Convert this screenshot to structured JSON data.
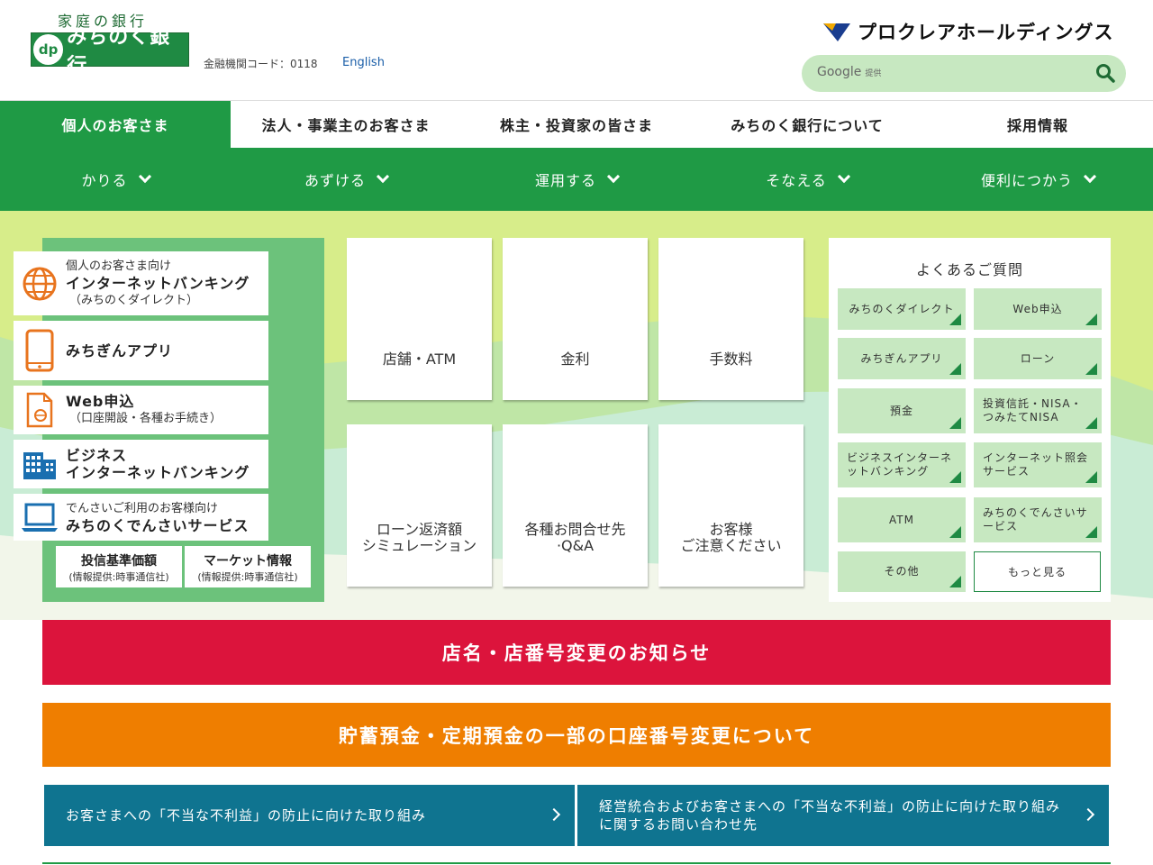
{
  "header": {
    "logo_tagline": "家庭の銀行",
    "logo_mark": "dp",
    "logo_name": "みちのく銀行",
    "bank_code": "金融機関コード：0118",
    "english_link": "English",
    "holdings_name": "プロクレアホールディングス",
    "search": {
      "brand": "Google",
      "brand_sub": "提供",
      "placeholder": ""
    }
  },
  "main_nav": [
    {
      "label": "個人のお客さま",
      "active": true
    },
    {
      "label": "法人・事業主のお客さま"
    },
    {
      "label": "株主・投資家の皆さま"
    },
    {
      "label": "みちのく銀行について"
    },
    {
      "label": "採用情報"
    }
  ],
  "sub_nav": [
    {
      "label": "かりる"
    },
    {
      "label": "あずける"
    },
    {
      "label": "運用する"
    },
    {
      "label": "そなえる"
    },
    {
      "label": "便利につかう"
    }
  ],
  "left_panel": {
    "internet_banking": {
      "small": "個人のお客さま向け",
      "big": "インターネットバンキング",
      "sub": "（みちのくダイレクト）"
    },
    "app": {
      "big": "みちぎんアプリ"
    },
    "web_apply": {
      "big": "Web申込",
      "sub": "（口座開設・各種お手続き）"
    },
    "business_ib": {
      "big1": "ビジネス",
      "big2": "インターネットバンキング"
    },
    "densai": {
      "small": "でんさいご利用のお客様向け",
      "big": "みちのくでんさいサービス"
    },
    "fund_price": {
      "title": "投信基準価額",
      "sub": "(情報提供:時事通信社)"
    },
    "market": {
      "title": "マーケット情報",
      "sub": "(情報提供:時事通信社)"
    }
  },
  "tiles": {
    "store_atm": "店舗・ATM",
    "rates": "金利",
    "fees": "手数料",
    "loan_sim_1": "ローン返済額",
    "loan_sim_2": "シミュレーション",
    "contact_1": "各種お問合せ先",
    "contact_2": "·Q&A",
    "caution_1": "お客様",
    "caution_2": "ご注意ください"
  },
  "faq": {
    "title": "よくあるご質問",
    "items": [
      "みちのくダイレクト",
      "Web申込",
      "みちぎんアプリ",
      "ローン",
      "預金",
      "投資信託・NISA・つみたてNISA",
      "ビジネスインターネットバンキング",
      "インターネット照会サービス",
      "ATM",
      "みちのくでんさいサービス",
      "その他"
    ],
    "more": "もっと見る"
  },
  "notices": {
    "red": "店名・店番号変更のお知らせ",
    "orange": "貯蓄預金・定期預金の一部の口座番号変更について",
    "info_left": "お客さまへの「不当な不利益」の防止に向けた取り組み",
    "info_right": "経営統合およびお客さまへの「不当な不利益」の防止に向けた取り組みに関するお問い合わせ先"
  },
  "colors": {
    "brand_green": "#1f9a45",
    "light_green": "#c7e8c1",
    "notice_red": "#dc143c",
    "notice_orange": "#ef7e00",
    "info_teal": "#0f7490"
  }
}
